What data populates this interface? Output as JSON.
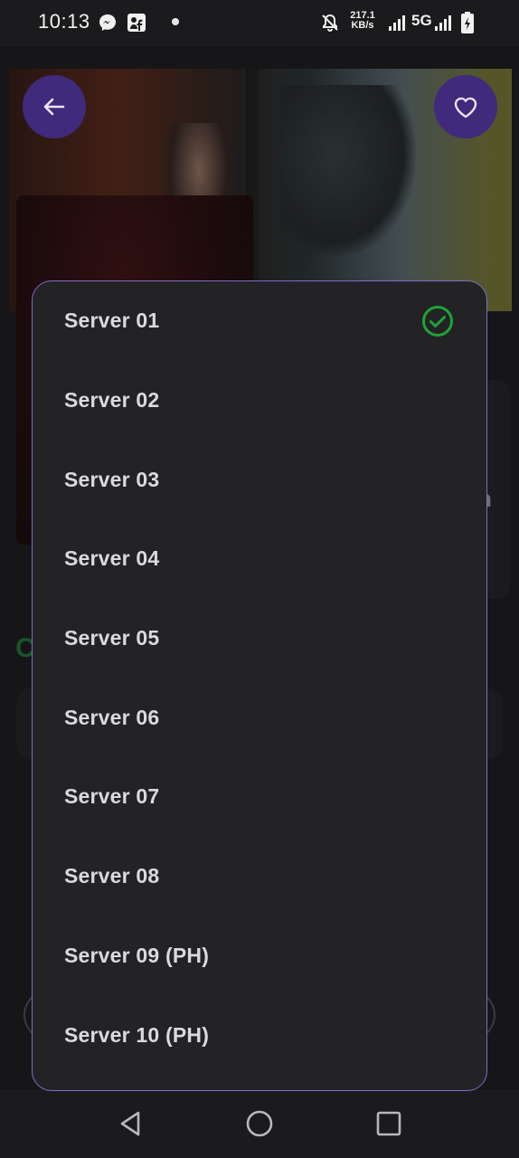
{
  "status_bar": {
    "time": "10:13",
    "net_speed_value": "217.1",
    "net_speed_unit": "KB/s",
    "network_type": "5G",
    "icons": [
      "messenger-icon",
      "facebook-icon",
      "dot-icon",
      "mute-icon",
      "signal-icon",
      "signal-icon",
      "battery-charging-icon"
    ]
  },
  "backdrop": {
    "side_letters": "r\nh",
    "green_mark": "C"
  },
  "buttons": {
    "back_icon": "arrow-left-icon",
    "favorite_icon": "heart-icon"
  },
  "server_list": {
    "selected_index": 0,
    "items": [
      {
        "label": "Server 01"
      },
      {
        "label": "Server 02"
      },
      {
        "label": "Server 03"
      },
      {
        "label": "Server 04"
      },
      {
        "label": "Server 05"
      },
      {
        "label": "Server 06"
      },
      {
        "label": "Server 07"
      },
      {
        "label": "Server 08"
      },
      {
        "label": "Server 09 (PH)"
      },
      {
        "label": "Server 10 (PH)"
      }
    ]
  },
  "colors": {
    "accent": "#3f2a7c",
    "sheet_border": "#7f6bc7",
    "check": "#1fa33a",
    "sheet_bg": "#232326"
  },
  "nav_bar": {
    "icons": [
      "back-triangle-icon",
      "home-circle-icon",
      "recents-square-icon"
    ]
  }
}
